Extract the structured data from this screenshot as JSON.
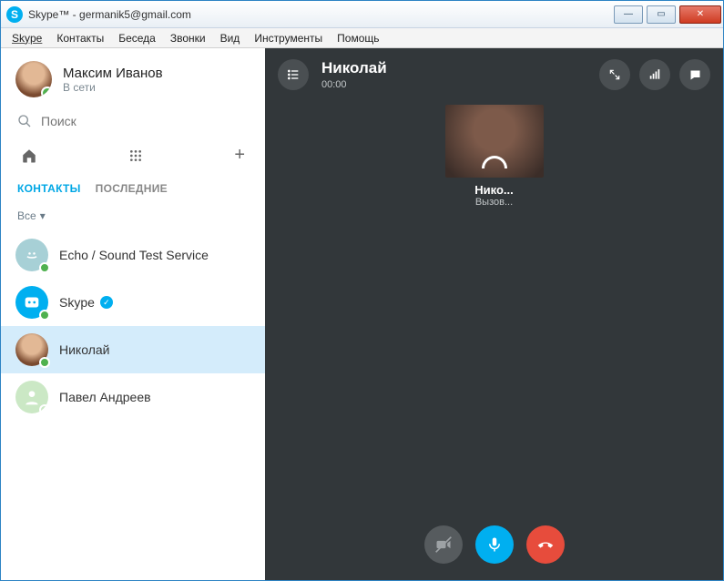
{
  "window": {
    "title": "Skype™ - germanik5@gmail.com"
  },
  "menu": {
    "items": [
      "Skype",
      "Контакты",
      "Беседа",
      "Звонки",
      "Вид",
      "Инструменты",
      "Помощь"
    ]
  },
  "profile": {
    "name": "Максим Иванов",
    "status": "В сети"
  },
  "search": {
    "placeholder": "Поиск"
  },
  "tabs": {
    "contacts": "КОНТАКТЫ",
    "recent": "ПОСЛЕДНИЕ"
  },
  "filter": {
    "label": "Все"
  },
  "contacts": [
    {
      "name": "Echo / Sound Test Service",
      "avatar": "echo",
      "presence": "online",
      "verified": false
    },
    {
      "name": "Skype",
      "avatar": "skype",
      "presence": "online",
      "verified": true
    },
    {
      "name": "Николай",
      "avatar": "person",
      "presence": "online",
      "verified": false,
      "selected": true
    },
    {
      "name": "Павел Андреев",
      "avatar": "placeholder",
      "presence": "offline",
      "verified": false
    }
  ],
  "call": {
    "callee": "Николай",
    "timer": "00:00",
    "thumb_name": "Нико...",
    "thumb_status": "Вызов..."
  }
}
